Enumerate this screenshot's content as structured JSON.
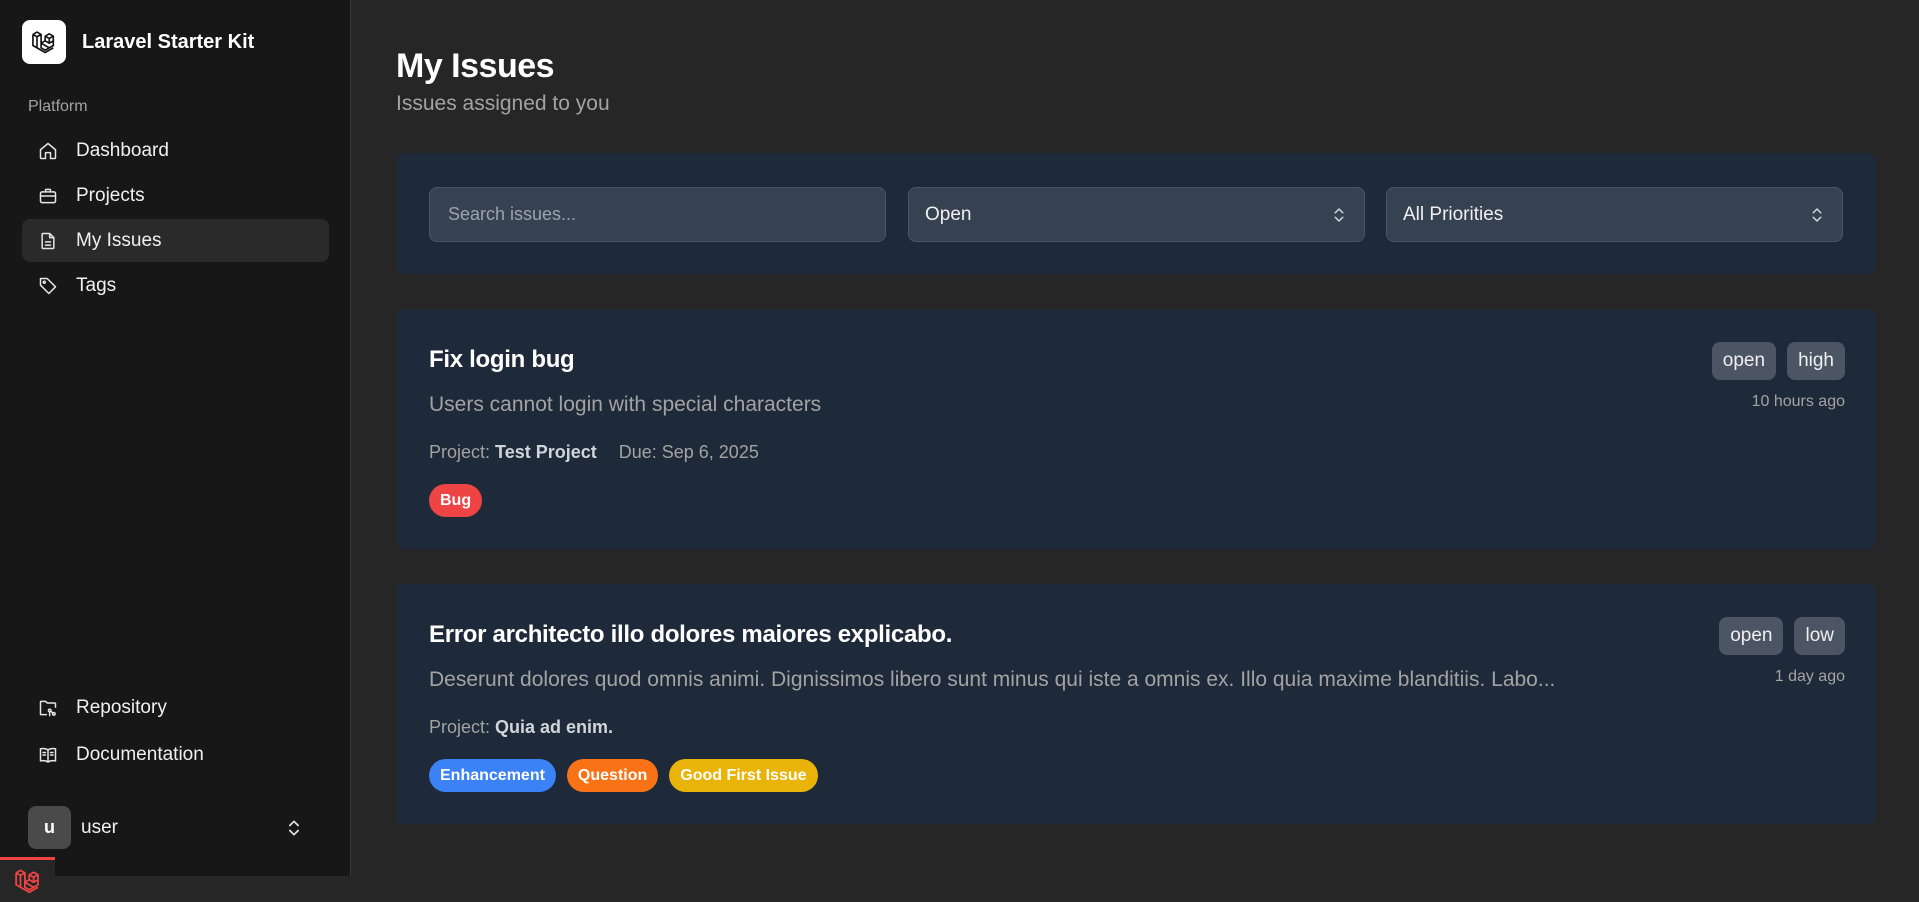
{
  "app": {
    "name": "Laravel Starter Kit"
  },
  "sidebar": {
    "section_label": "Platform",
    "items": [
      {
        "label": "Dashboard",
        "icon": "home-icon"
      },
      {
        "label": "Projects",
        "icon": "briefcase-icon"
      },
      {
        "label": "My Issues",
        "icon": "document-icon",
        "active": true
      },
      {
        "label": "Tags",
        "icon": "tag-icon"
      }
    ],
    "bottom_items": [
      {
        "label": "Repository",
        "icon": "folder-git-icon"
      },
      {
        "label": "Documentation",
        "icon": "book-open-icon"
      }
    ],
    "user": {
      "initial": "u",
      "name": "user"
    }
  },
  "page": {
    "title": "My Issues",
    "subtitle": "Issues assigned to you"
  },
  "filters": {
    "search_placeholder": "Search issues...",
    "status_value": "Open",
    "priority_value": "All Priorities"
  },
  "issues": [
    {
      "title": "Fix login bug",
      "description": "Users cannot login with special characters",
      "project_label": "Project:",
      "project": "Test Project",
      "due": "Due: Sep 6, 2025",
      "status": "open",
      "priority": "high",
      "time": "10 hours ago",
      "tags": [
        {
          "label": "Bug",
          "color": "#ef4444"
        }
      ]
    },
    {
      "title": "Error architecto illo dolores maiores explicabo.",
      "description": "Deserunt dolores quod omnis animi. Dignissimos libero sunt minus qui iste a omnis ex. Illo quia maxime blanditiis. Labo...",
      "project_label": "Project:",
      "project": "Quia ad enim.",
      "due": "",
      "status": "open",
      "priority": "low",
      "time": "1 day ago",
      "tags": [
        {
          "label": "Enhancement",
          "color": "#3b82f6"
        },
        {
          "label": "Question",
          "color": "#f97316"
        },
        {
          "label": "Good First Issue",
          "color": "#eab308"
        }
      ]
    }
  ],
  "colors": {
    "sidebar_bg": "#171717",
    "main_bg": "#262626",
    "card_bg": "#1e2939",
    "active_nav_bg": "#2a2a2a",
    "accent_red": "#ef4444"
  }
}
